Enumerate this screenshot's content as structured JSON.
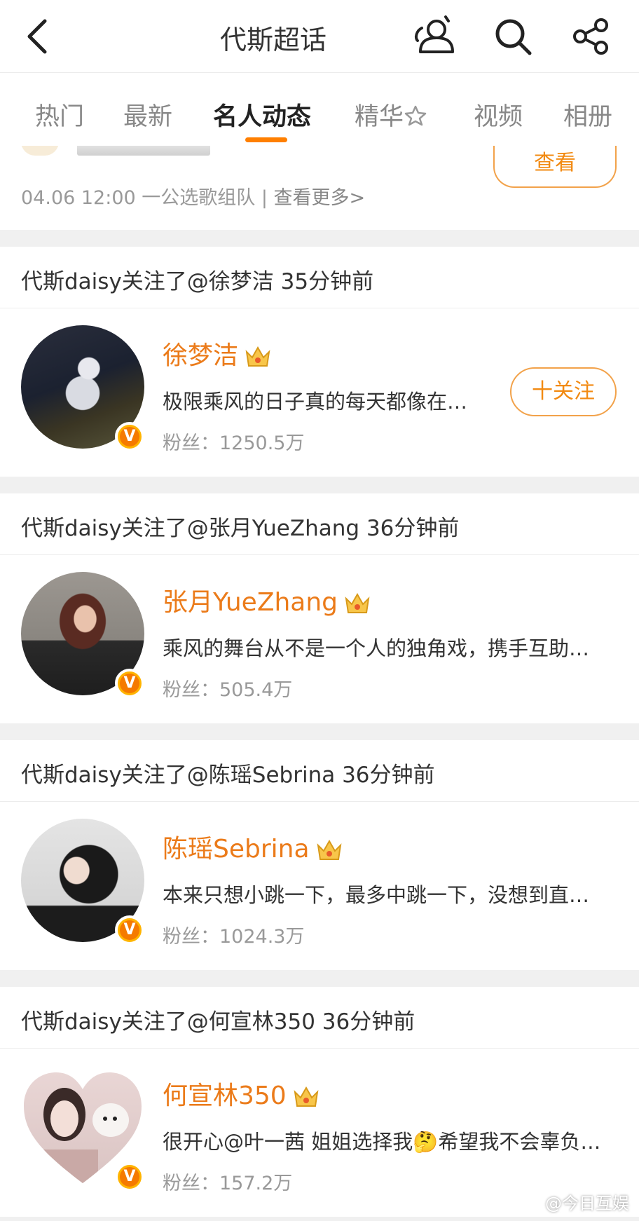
{
  "header": {
    "title": "代斯超话"
  },
  "tabs": [
    {
      "label": "热门"
    },
    {
      "label": "最新"
    },
    {
      "label": "名人动态"
    },
    {
      "label": "精华"
    },
    {
      "label": "视频"
    },
    {
      "label": "相册"
    }
  ],
  "active_tab": "名人动态",
  "event": {
    "info": "04.06 12:00 一公选歌组队 | ",
    "more": "查看更多>",
    "view_button": "查看"
  },
  "follows": [
    {
      "label": "代斯daisy关注了@徐梦洁 35分钟前",
      "name": "徐梦洁",
      "desc": "极限乘风的日子真的每天都像在…",
      "fans": "粉丝：1250.5万",
      "follow_button": "十关注",
      "badge": "V"
    },
    {
      "label": "代斯daisy关注了@张月YueZhang 36分钟前",
      "name": "张月YueZhang",
      "desc": "乘风的舞台从不是一个人的独角戏，携手互助…",
      "fans": "粉丝：505.4万",
      "badge": "V"
    },
    {
      "label": "代斯daisy关注了@陈瑶Sebrina 36分钟前",
      "name": "陈瑶Sebrina",
      "desc": "本来只想小跳一下，最多中跳一下，没想到直…",
      "fans": "粉丝：1024.3万",
      "badge": "V"
    },
    {
      "label": "代斯daisy关注了@何宣林350 36分钟前",
      "name": "何宣林350",
      "desc": "很开心@叶一茜 姐姐选择我🤔希望我不会辜负…",
      "fans": "粉丝：157.2万",
      "badge": "V"
    }
  ],
  "watermark": "@今日互娱",
  "colors": {
    "accent": "#ff7f00",
    "name": "#eb7b1a",
    "badge": "#ffb400"
  }
}
